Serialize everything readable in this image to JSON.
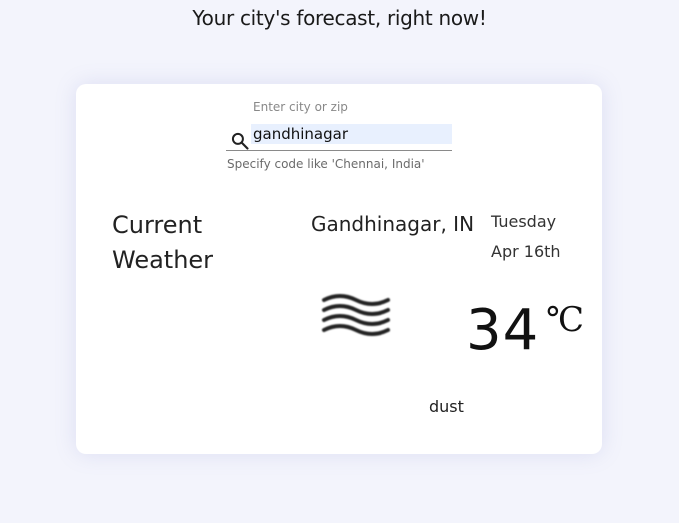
{
  "header": {
    "tagline": "Your city's forecast, right now!"
  },
  "search": {
    "label": "Enter city or zip",
    "value": "gandhinagar",
    "helper": "Specify code like 'Chennai, India'"
  },
  "weather": {
    "heading": "Current Weather",
    "location": "Gandhinagar, IN",
    "day": "Tuesday",
    "date": "Apr 16th",
    "temperature": "34",
    "unit": "℃",
    "description": "dust",
    "icon": "haze-icon"
  }
}
